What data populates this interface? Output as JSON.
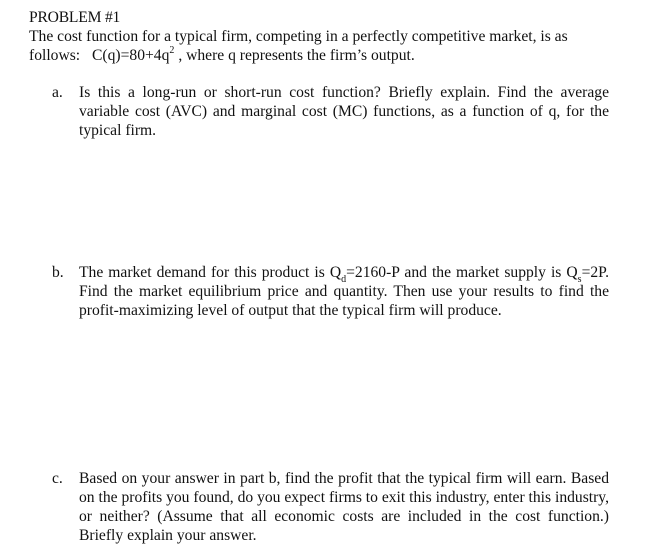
{
  "problem": {
    "title": "PROBLEM #1",
    "intro_line1": "The cost function for a typical firm, competing in a perfectly competitive market, is as",
    "intro_line2_prefix": "follows:",
    "cost_function_base": "C(q)=80+4q",
    "cost_function_exponent": "2",
    "intro_line2_suffix": ", where q represents the firm’s output."
  },
  "questions": [
    {
      "letter": "a.",
      "text": "Is this a long-run or short-run cost function? Briefly explain.  Find the average variable cost (AVC) and marginal cost (MC) functions, as a function of q, for the typical firm."
    },
    {
      "letter": "b.",
      "text_part1": "The market demand for this product is Q",
      "demand_subscript": "d",
      "text_part2": "=2160-P and the market supply is Q",
      "supply_subscript": "s",
      "text_part3": "=2P. Find the market equilibrium price and quantity.  Then use your results to find the profit-maximizing level of output that the typical firm will produce."
    },
    {
      "letter": "c.",
      "text": "Based on your answer in part b, find the profit that the typical firm will earn.  Based on the profits you found, do you expect firms to exit this industry, enter this industry, or neither?  (Assume that all economic costs are included in the cost function.) Briefly explain your answer."
    }
  ]
}
